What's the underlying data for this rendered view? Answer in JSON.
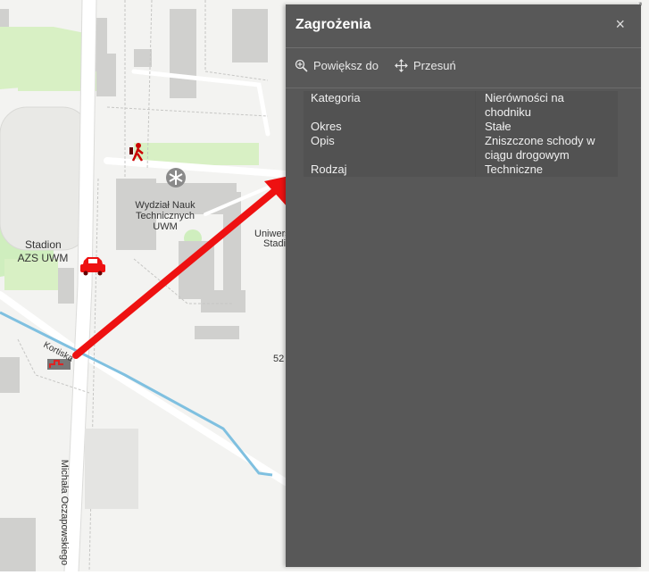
{
  "map": {
    "labels": {
      "stadion": "Stadion",
      "azs": "AZS UWM",
      "wydzial": "Wydział Nauk",
      "technicznych": "Technicznych",
      "uwm": "UWM",
      "uniwers": "Uniwers",
      "stadi": "Stadi",
      "street_korczynska": "Kortiska",
      "street_oczapowskiego": "Michała Oczapowskiego",
      "number_52": "52"
    },
    "icons": [
      "hiker-icon",
      "snowflake-icon",
      "car-icon",
      "stairs-icon"
    ],
    "accent_arrow_color": "#ee1111"
  },
  "panel": {
    "title": "Zagrożenia",
    "close": "×",
    "tools": {
      "zoom_label": "Powiększ do",
      "pan_label": "Przesuń"
    },
    "attributes": [
      {
        "key": "Kategoria",
        "value": "Nierówności na chodniku"
      },
      {
        "key": "Okres",
        "value": "Stałe"
      },
      {
        "key": "Opis",
        "value": "Zniszczone schody w ciągu drogowym"
      },
      {
        "key": "Rodzaj",
        "value": "Techniczne"
      }
    ],
    "background_color": "#585858"
  }
}
